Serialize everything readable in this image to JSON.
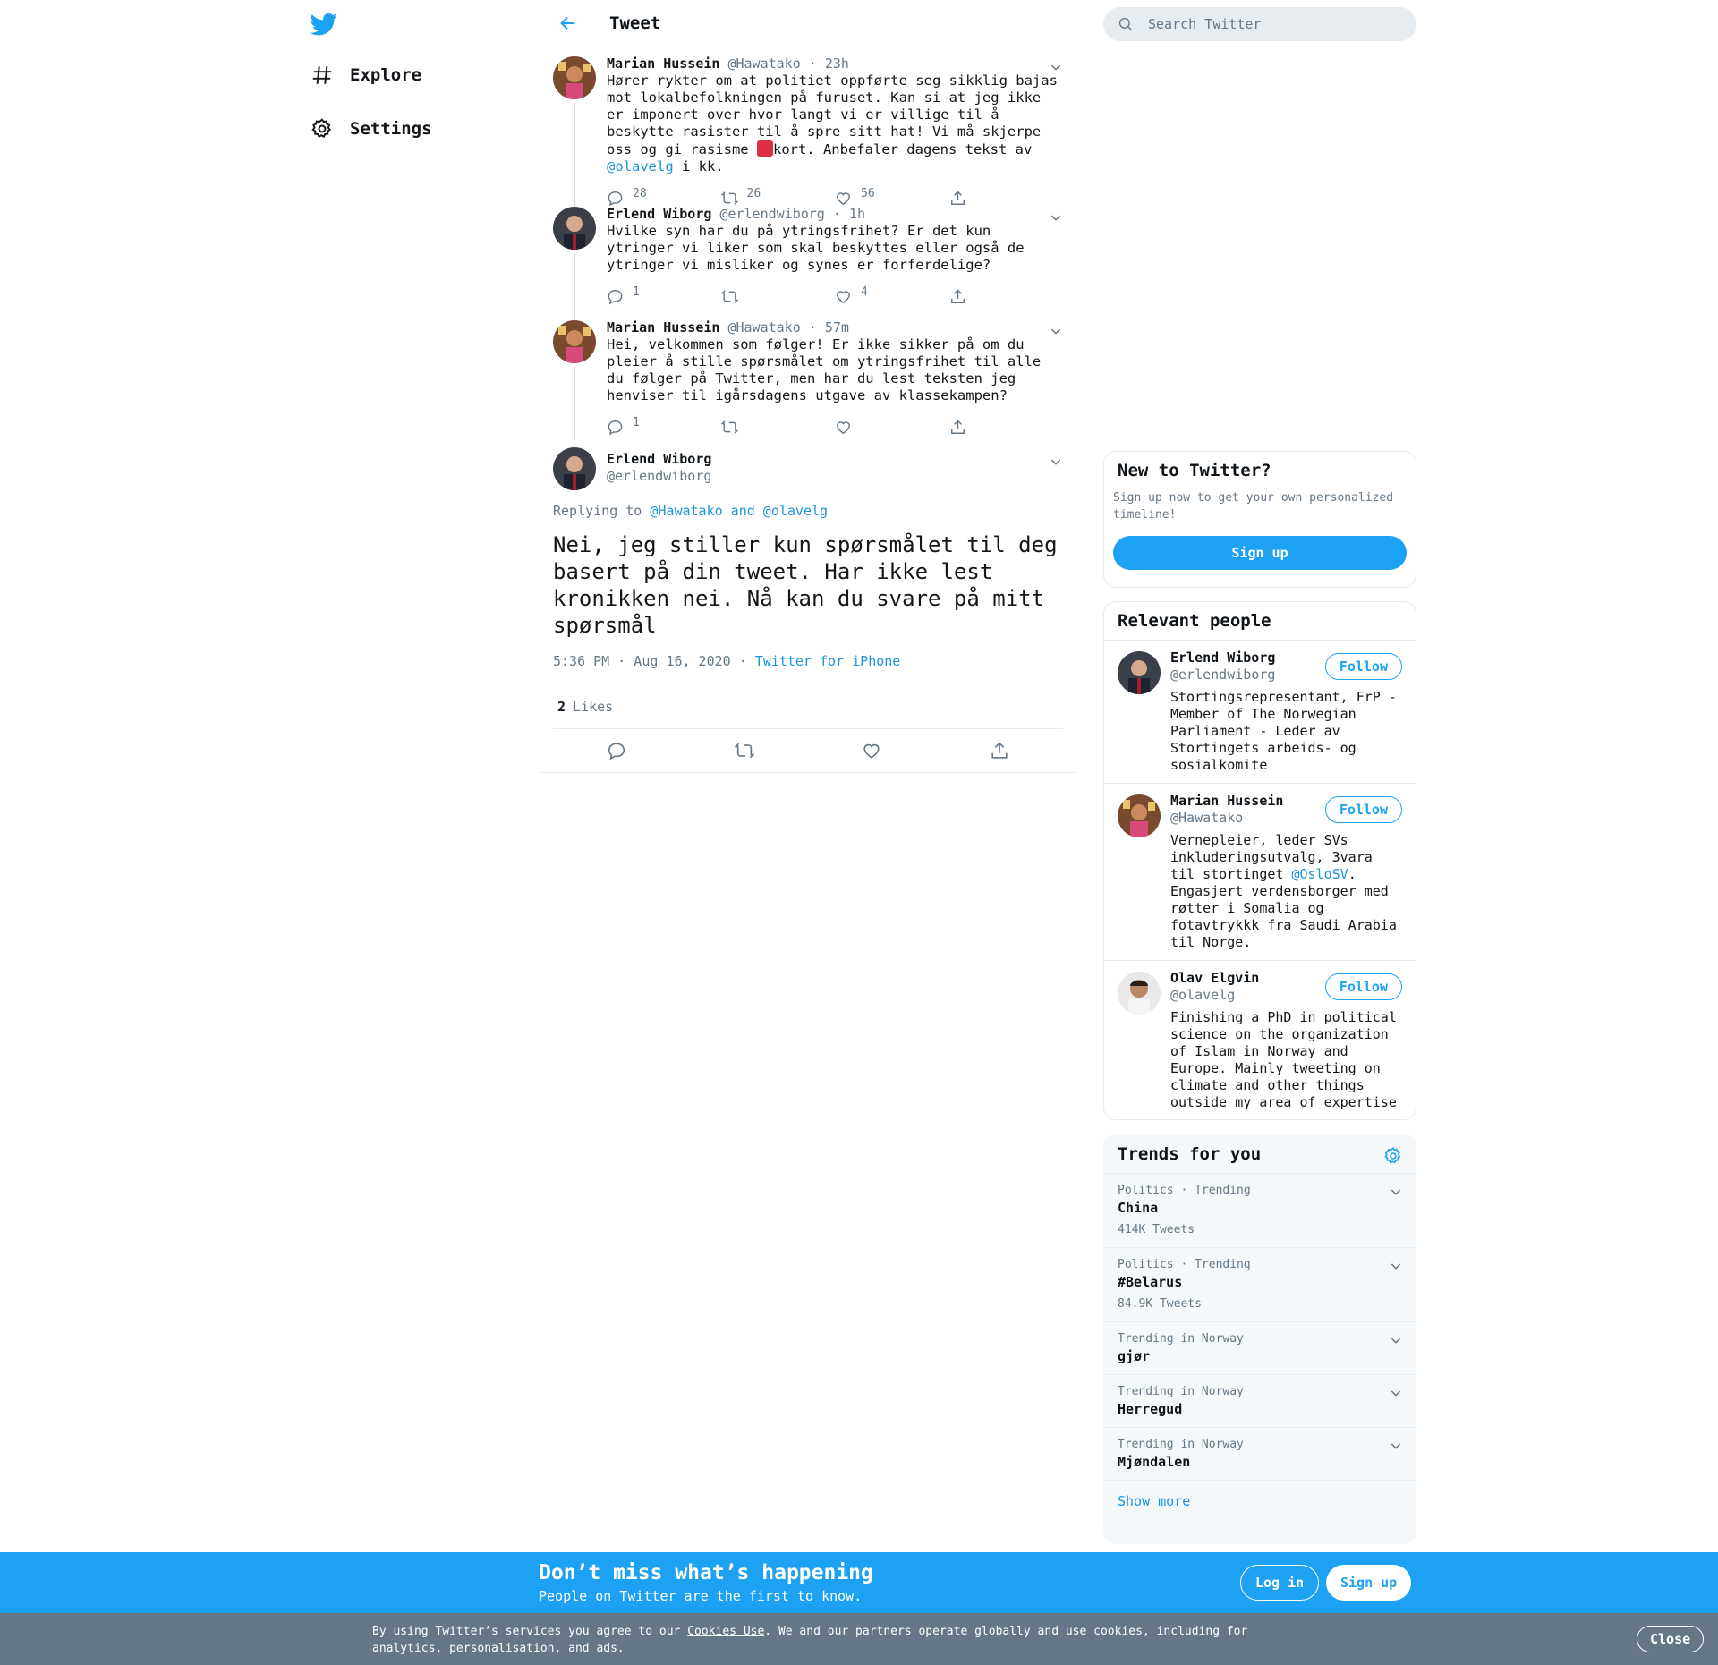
{
  "nav": {
    "items": [
      {
        "label": "Explore"
      },
      {
        "label": "Settings"
      }
    ]
  },
  "header": {
    "title": "Tweet"
  },
  "thread": [
    {
      "name": "Marian Hussein",
      "handle": "@Hawatako",
      "time": "· 23h",
      "text_before": "Hører rykter om at politiet oppførte seg sikklig bajas mot lokalbefolkningen på furuset. Kan si at jeg ikke er imponert over hvor langt vi er villige til å beskytte rasister til å spre sitt hat! Vi må skjerpe oss og gi rasisme ",
      "text_after": "kort. Anbefaler dagens tekst av ",
      "mention": "@olavelg",
      "text_end": " i kk.",
      "replies": "28",
      "retweets": "26",
      "likes": "56"
    },
    {
      "name": "Erlend Wiborg",
      "handle": "@erlendwiborg",
      "time": "· 1h",
      "text": "Hvilke syn har du på ytringsfrihet? Er det kun ytringer vi liker som skal beskyttes eller også de ytringer vi misliker og synes er forferdelige?",
      "replies": "1",
      "retweets": "",
      "likes": "4"
    },
    {
      "name": "Marian Hussein",
      "handle": "@Hawatako",
      "time": "· 57m",
      "text": "Hei, velkommen som følger! Er ikke sikker på om du pleier å stille spørsmålet om ytringsfrihet til alle du følger på Twitter, men har du lest teksten jeg henviser til igårsdagens utgave av klassekampen?",
      "replies": "1",
      "retweets": "",
      "likes": ""
    }
  ],
  "main": {
    "name": "Erlend Wiborg",
    "handle": "@erlendwiborg",
    "replying_label": "Replying to",
    "replying_to": "@Hawatako and @olavelg",
    "text": "Nei, jeg stiller kun spørsmålet til deg basert på din tweet. Har ikke lest kronikken nei. Nå kan du svare på mitt spørsmål",
    "timestamp": "5:36 PM · Aug 16, 2020 · ",
    "source": "Twitter for iPhone",
    "like_count": "2",
    "like_label": "Likes"
  },
  "search": {
    "placeholder": "Search Twitter"
  },
  "new_to_twitter": {
    "title": "New to Twitter?",
    "subtitle": "Sign up now to get your own personalized timeline!",
    "button": "Sign up"
  },
  "relevant": {
    "title": "Relevant people",
    "follow_label": "Follow",
    "people": [
      {
        "name": "Erlend Wiborg",
        "handle": "@erlendwiborg",
        "bio": "Stortingsrepresentant, FrP - Member of The Norwegian Parliament - Leder av Stortingets arbeids- og sosialkomite"
      },
      {
        "name": "Marian Hussein",
        "handle": "@Hawatako",
        "bio_before": "Vernepleier, leder SVs inkluderingsutvalg, 3vara til stortinget ",
        "bio_mention": "@OsloSV",
        "bio_after": ". Engasjert verdensborger med røtter i Somalia og fotavtrykkk fra Saudi Arabia til Norge."
      },
      {
        "name": "Olav Elgvin",
        "handle": "@olavelg",
        "bio": "Finishing a PhD in political science on the organization of Islam in Norway and Europe. Mainly tweeting on climate and other things outside my area of expertise"
      }
    ]
  },
  "trends": {
    "title": "Trends for you",
    "items": [
      {
        "category": "Politics · Trending",
        "name": "China",
        "count": "414K Tweets"
      },
      {
        "category": "Politics · Trending",
        "name": "#Belarus",
        "count": "84.9K Tweets"
      },
      {
        "category": "Trending in Norway",
        "name": "gjør",
        "count": ""
      },
      {
        "category": "Trending in Norway",
        "name": "Herregud",
        "count": ""
      },
      {
        "category": "Trending in Norway",
        "name": "Mjøndalen",
        "count": ""
      }
    ],
    "show_more": "Show more"
  },
  "banner": {
    "title": "Don’t miss what’s happening",
    "subtitle": "People on Twitter are the first to know.",
    "login": "Log in",
    "signup": "Sign up"
  },
  "cookie": {
    "text_before": "By using Twitter’s services you agree to our ",
    "link": "Cookies Use",
    "text_after": ". We and our partners operate globally and use cookies, including for analytics, personalisation, and ads.",
    "close": "Close"
  },
  "colors": {
    "brand": "#1da1f2",
    "link": "#1b95e0",
    "muted": "#657786",
    "cookie_bg": "#657786"
  }
}
